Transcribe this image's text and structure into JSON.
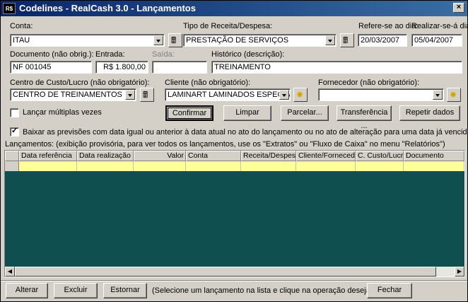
{
  "window": {
    "icon_text": "R$",
    "title": "Codelines - RealCash 3.0 - Lançamentos",
    "close": "×"
  },
  "labels": {
    "conta": "Conta:",
    "tipo": "Tipo de Receita/Despesa:",
    "refere": "Refere-se ao dia:",
    "realizar": "Realizar-se-á dia:",
    "documento": "Documento (não obrig.):",
    "entrada": "Entrada:",
    "saida": "Saída:",
    "historico": "Histórico (descrição):",
    "centro": "Centro de Custo/Lucro (não obrigatório):",
    "cliente": "Cliente (não obrigatório):",
    "fornecedor": "Fornecedor (não obrigatório):",
    "multiplas": "Lançar múltiplas vezes",
    "baixar": "Baixar as previsões com data igual ou anterior à data atual no ato do lançamento ou no ato de alteração para uma data já vencida",
    "lancamentos": "Lançamentos: (exibição provisória, para ver todos os lançamentos, use os \"Extratos\" ou \"Fluxo de Caixa\" no menu \"Relatórios\")",
    "hint": "(Selecione um lançamento na lista e clique na operação desejada)"
  },
  "values": {
    "conta": "ITAU",
    "tipo": "PRESTAÇÃO DE SERVIÇOS",
    "refere": "20/03/2007",
    "realizar": "05/04/2007",
    "documento": "NF 001045",
    "entrada": "R$ 1.800,00",
    "saida": "",
    "historico": "TREINAMENTO",
    "centro": "CENTRO DE TREINAMENTOS",
    "cliente": "LAMINART LAMINADOS ESPECIAIS",
    "fornecedor": ""
  },
  "checks": {
    "multiplas": false,
    "baixar": true
  },
  "buttons": {
    "confirmar": "Confirmar",
    "limpar": "Limpar",
    "parcelar": "Parcelar...",
    "transferencia": "Transferência ...",
    "repetir": "Repetir dados",
    "alterar": "Alterar",
    "excluir": "Excluir",
    "estornar": "Estornar",
    "fechar": "Fechar"
  },
  "grid": {
    "columns": [
      "Data referência",
      "Data realização",
      "Valor",
      "Conta",
      "Receita/Despesa",
      "Cliente/Fornecedor",
      "C. Custo/Lucro",
      "Documento"
    ]
  },
  "icons": {
    "lookup": "calculator-icon",
    "new": "sun-icon"
  },
  "colors": {
    "grid_bg": "#0f4f4f",
    "row_highlight": "#ffff99",
    "title_start": "#0a246a",
    "title_end": "#3a6ea5"
  }
}
